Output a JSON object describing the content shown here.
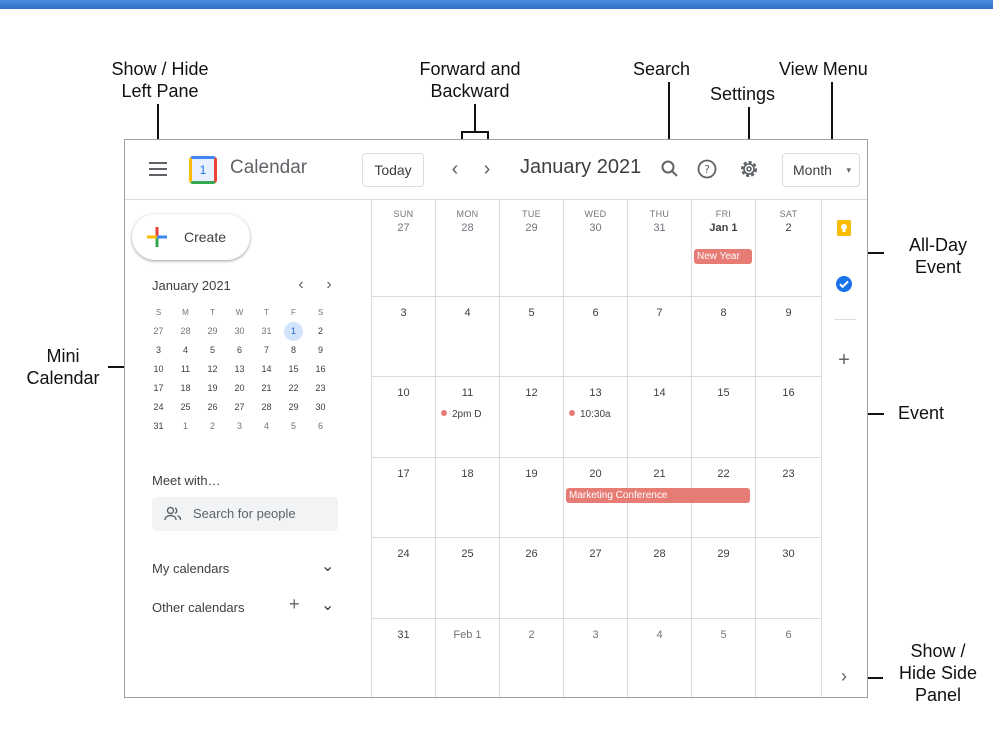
{
  "annotations": {
    "show_hide_left_pane": "Show / Hide\nLeft Pane",
    "forward_backward": "Forward and\nBackward",
    "search": "Search",
    "settings": "Settings",
    "view_menu": "View Menu",
    "all_day_event": "All-Day\nEvent",
    "mini_calendar": "Mini\nCalendar",
    "event": "Event",
    "show_hide_side_panel": "Show /\nHide Side\nPanel"
  },
  "header": {
    "app_title": "Calendar",
    "logo_number": "1",
    "today_label": "Today",
    "prev_icon": "‹",
    "next_icon": "›",
    "month_title": "January 2021",
    "search_icon": "search-icon",
    "help_icon": "help-icon",
    "settings_icon": "gear-icon",
    "view_label": "Month",
    "view_caret": "▾"
  },
  "left_pane": {
    "create_label": "Create",
    "mini_title": "January 2021",
    "mini_prev": "‹",
    "mini_next": "›",
    "mini_days_of_week": [
      "S",
      "M",
      "T",
      "W",
      "T",
      "F",
      "S"
    ],
    "mini_weeks": [
      [
        "27",
        "28",
        "29",
        "30",
        "31",
        "1",
        "2"
      ],
      [
        "3",
        "4",
        "5",
        "6",
        "7",
        "8",
        "9"
      ],
      [
        "10",
        "11",
        "12",
        "13",
        "14",
        "15",
        "16"
      ],
      [
        "17",
        "18",
        "19",
        "20",
        "21",
        "22",
        "23"
      ],
      [
        "24",
        "25",
        "26",
        "27",
        "28",
        "29",
        "30"
      ],
      [
        "31",
        "1",
        "2",
        "3",
        "4",
        "5",
        "6"
      ]
    ],
    "mini_selected": "1",
    "meet_with_label": "Meet with…",
    "search_people_placeholder": "Search for people",
    "my_calendars_label": "My calendars",
    "other_calendars_label": "Other calendars",
    "chevron": "⌄",
    "plus": "+"
  },
  "month_grid": {
    "days_of_week": [
      "SUN",
      "MON",
      "TUE",
      "WED",
      "THU",
      "FRI",
      "SAT"
    ],
    "weeks": [
      [
        "27",
        "28",
        "29",
        "30",
        "31",
        "Jan 1",
        "2"
      ],
      [
        "3",
        "4",
        "5",
        "6",
        "7",
        "8",
        "9"
      ],
      [
        "10",
        "11",
        "12",
        "13",
        "14",
        "15",
        "16"
      ],
      [
        "17",
        "18",
        "19",
        "20",
        "21",
        "22",
        "23"
      ],
      [
        "24",
        "25",
        "26",
        "27",
        "28",
        "29",
        "30"
      ],
      [
        "31",
        "Feb 1",
        "2",
        "3",
        "4",
        "5",
        "6"
      ]
    ],
    "all_day_event": "New Year",
    "timed_event_1": "2pm D",
    "timed_event_2": "10:30a",
    "multi_day_event": "Marketing Conference",
    "event_color": "#e67c73"
  },
  "side_panel": {
    "keep_icon": "keep-icon",
    "tasks_icon": "tasks-icon",
    "add_icon": "+",
    "toggle_icon": "›"
  },
  "colors": {
    "top_bar": "#2f6fc9",
    "accent_blue": "#1a73e8",
    "selected_day": "#d2e3fc"
  }
}
